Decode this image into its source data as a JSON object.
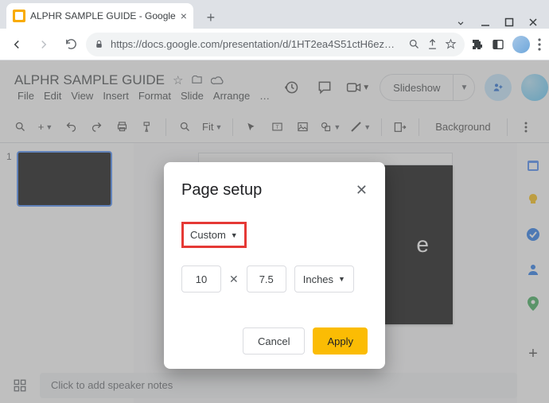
{
  "browser": {
    "tab_title": "ALPHR SAMPLE GUIDE - Google ",
    "url": "https://docs.google.com/presentation/d/1HT2ea4S51ctH6ezCFHw9..."
  },
  "doc": {
    "title": "ALPHR SAMPLE GUIDE",
    "menus": [
      "File",
      "Edit",
      "View",
      "Insert",
      "Format",
      "Slide",
      "Arrange",
      "…"
    ]
  },
  "header_buttons": {
    "slideshow": "Slideshow"
  },
  "toolbar": {
    "fit": "Fit",
    "background": "Background"
  },
  "slides": {
    "thumb_number": "1",
    "canvas_text_fragment": "e"
  },
  "notes": {
    "placeholder": "Click to add speaker notes"
  },
  "modal": {
    "title": "Page setup",
    "preset": "Custom",
    "width": "10",
    "height": "7.5",
    "unit": "Inches",
    "cancel": "Cancel",
    "apply": "Apply"
  },
  "side_icons": {
    "a": "calendar",
    "b": "keep",
    "c": "tasks",
    "d": "contacts",
    "e": "maps",
    "f": "add"
  }
}
